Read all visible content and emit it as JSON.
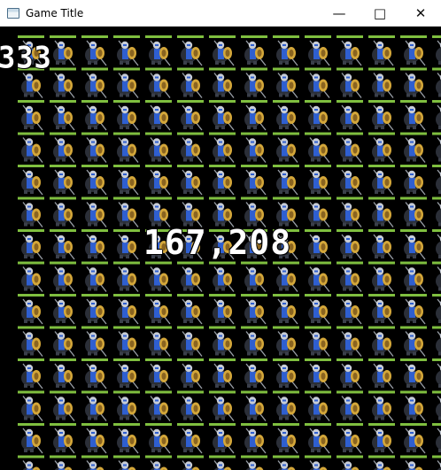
{
  "window": {
    "title": "Game Title",
    "minimize_glyph": "—",
    "maximize_glyph": "□",
    "close_glyph": "✕"
  },
  "game": {
    "fps_display": "333",
    "sprite_count_display": "167,208",
    "sprite": {
      "name": "armored-knight-sprite",
      "health_bar_color": "#7fbf3f",
      "armor_color": "#2f5fd0",
      "accent_color": "#d4a73a"
    }
  }
}
